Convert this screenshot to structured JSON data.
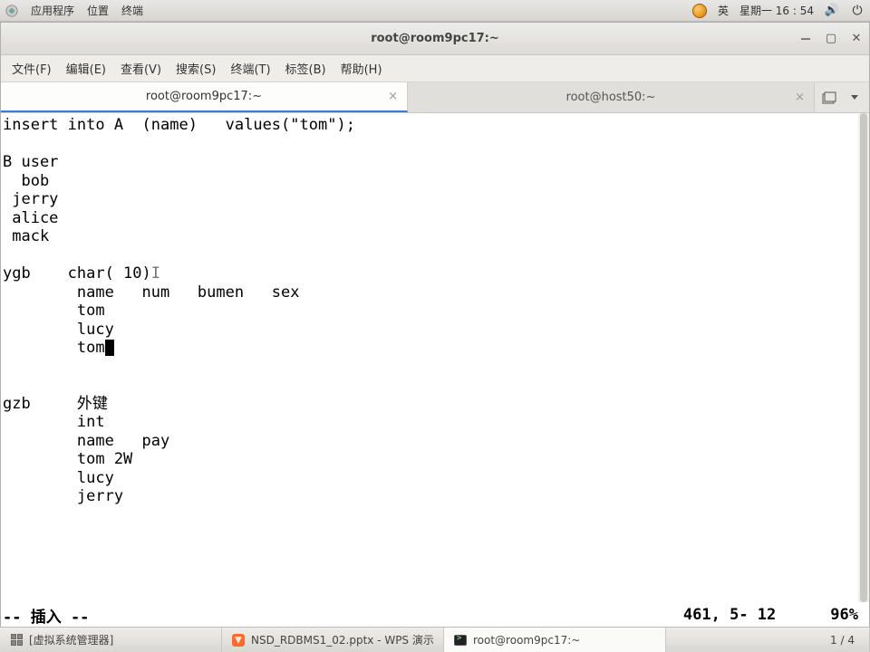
{
  "panel": {
    "menu_apps": "应用程序",
    "menu_places": "位置",
    "menu_terminal": "终端",
    "ime": "英",
    "clock": "星期一  16 : 54"
  },
  "window": {
    "title": "root@room9pc17:~",
    "menubar": {
      "file": "文件(F)",
      "edit": "编辑(E)",
      "view": "查看(V)",
      "search": "搜索(S)",
      "terminal": "终端(T)",
      "tabs": "标签(B)",
      "help": "帮助(H)"
    },
    "tabs": [
      {
        "label": "root@room9pc17:~",
        "active": true
      },
      {
        "label": "root@host50:~",
        "active": false
      }
    ],
    "terminal_lines": [
      "insert into A  (name)   values(\"tom\");",
      "",
      "B user",
      "  bob",
      " jerry",
      " alice",
      " mack",
      "",
      "ygb    char( 10)",
      "        name   num   bumen   sex",
      "        tom",
      "        lucy",
      "        tom",
      "",
      "",
      "gzb     外键",
      "        int",
      "        name   pay",
      "        tom 2W",
      "        lucy",
      "        jerry"
    ],
    "cursor_line_index": 12,
    "cursor_after_text": "        tom",
    "text_caret_line_index": 8,
    "text_caret_col": 22,
    "status": {
      "mode": "-- 插入 --",
      "position": "461, 5- 12",
      "scroll": "96%"
    }
  },
  "taskbar": {
    "items": [
      {
        "label": "[虚拟系统管理器]",
        "icon": "vm-icon"
      },
      {
        "label": "NSD_RDBMS1_02.pptx - WPS 演示",
        "icon": "wps-icon"
      },
      {
        "label": "root@room9pc17:~",
        "icon": "term-icon",
        "active": true
      }
    ],
    "pager": "1 / 4"
  }
}
